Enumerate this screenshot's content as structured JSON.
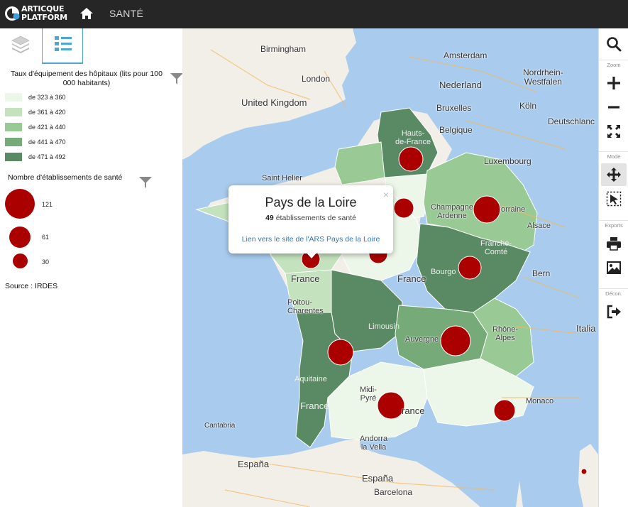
{
  "topbar": {
    "logo_line1": "ARTICQUE",
    "logo_line2": "PLATFORM",
    "section_title": "SANTÉ"
  },
  "legend": {
    "choropleth_title": "Taux d'équipement des hôpitaux (lits pour 100 000 habitants)",
    "classes": [
      {
        "label": "de 323 à 360",
        "color": "#edf7e9"
      },
      {
        "label": "de 361 à 420",
        "color": "#c3e2bd"
      },
      {
        "label": "de 421 à 440",
        "color": "#99c994"
      },
      {
        "label": "de 441 à 470",
        "color": "#76aa79"
      },
      {
        "label": "de 471 à 492",
        "color": "#5a8a64"
      }
    ],
    "symbols_title": "Nombre d'établissements de santé",
    "symbols": [
      {
        "label": "121"
      },
      {
        "label": "61"
      },
      {
        "label": "30"
      }
    ],
    "source": "Source : IRDES"
  },
  "map": {
    "labels": {
      "birmingham": "Birmingham",
      "amsterdam": "Amsterdam",
      "london": "London",
      "nederland": "Nederland",
      "nordrhein": "Nordrhein-\nWestfalen",
      "united_kingdom": "United Kingdom",
      "bruxelles": "Bruxelles",
      "koln": "Köln",
      "belgique": "Belgique",
      "deutschland": "Deutschlanc",
      "luxembourg": "Luxembourg",
      "saint_helier": "Saint Helier",
      "hauts_de_france": "Hauts-\nde-France",
      "champagne": "Champagne\nArdenne",
      "lorraine": "orraine",
      "alsace": "Alsace",
      "franche_comte": "Franche-\nComté",
      "bourgogne": "Bourgo",
      "bern": "Bern",
      "france_center": "France",
      "france_ouest": "France",
      "poitou": "Poitou-\nCharentes",
      "limousin": "Limousin",
      "auvergne": "Auvergne",
      "rhone_alpes": "Rhône-\nAlpes",
      "italia": "Italia",
      "aquitaine": "Aquitaine",
      "france_sw": "France",
      "midi_pyrenees": "Midi-\nPyré",
      "france_s": "rance",
      "monaco": "Monaco",
      "cantabria": "Cantabria",
      "andorra": "Andorra\nla Vella",
      "espana1": "España",
      "espana2": "España",
      "barcelona": "Barcelona"
    }
  },
  "popup": {
    "title": "Pays de la Loire",
    "count": "49",
    "count_suffix": "établissements de santé",
    "link": "Lien vers le site de l'ARS Pays de la Loire",
    "close": "×"
  },
  "toolbar": {
    "zoom_label": "Zoom",
    "mode_label": "Mode",
    "exports_label": "Exports",
    "logout_label": "Décon."
  }
}
